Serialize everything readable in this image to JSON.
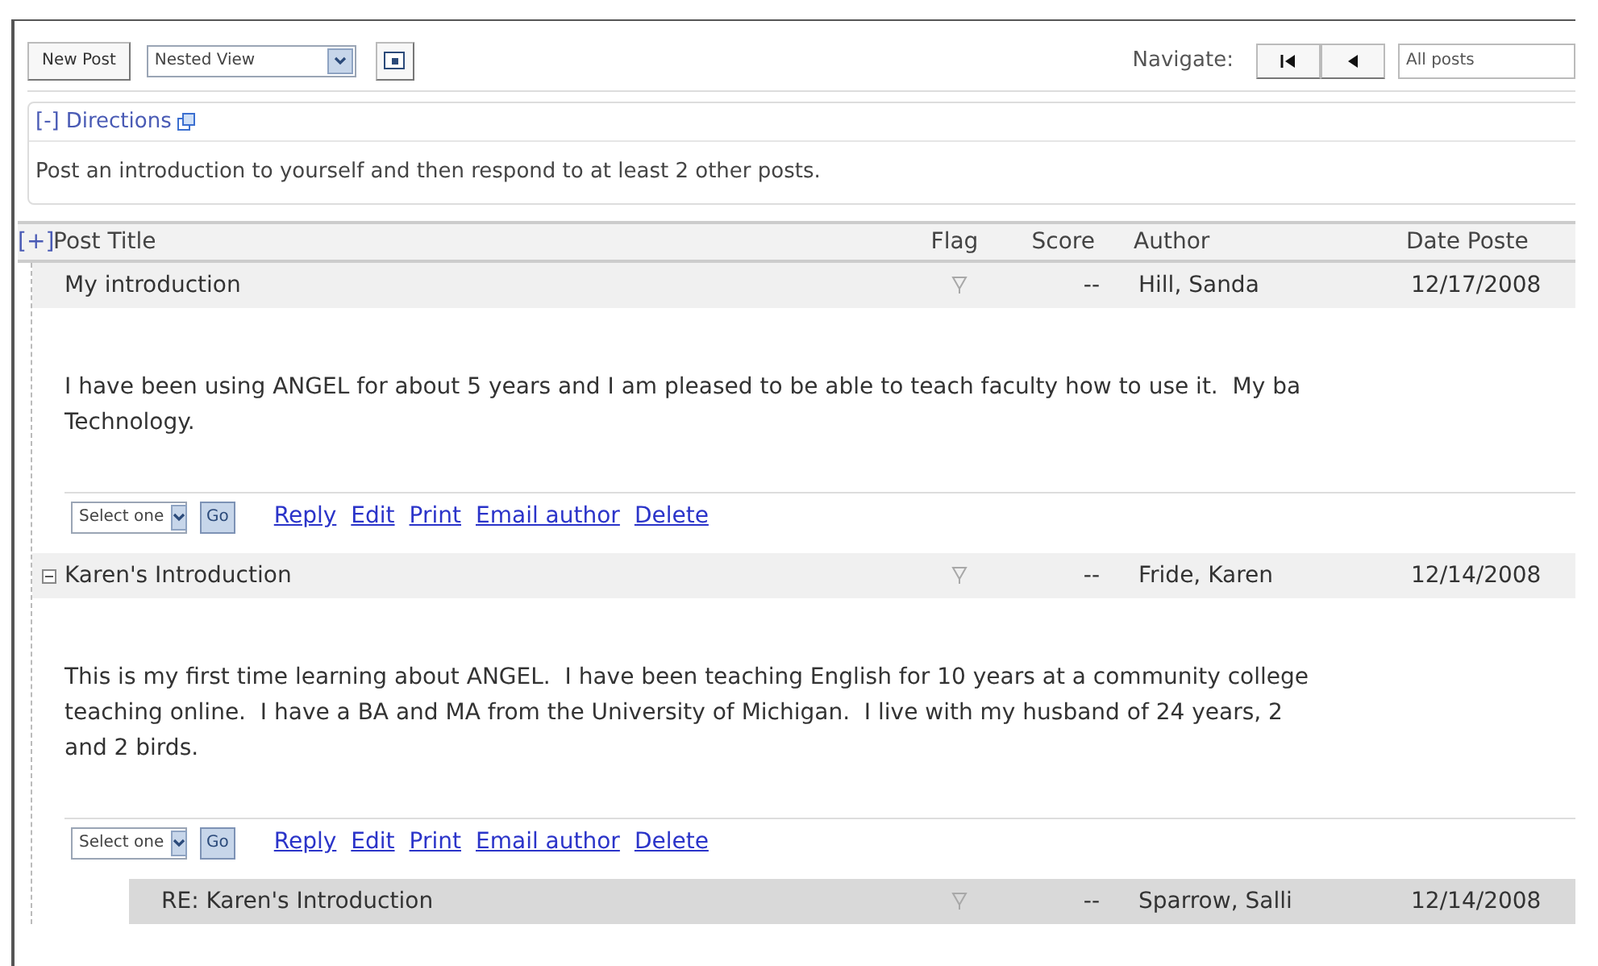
{
  "toolbar": {
    "new_post": "New Post",
    "view_select": "Nested View",
    "navigate_label": "Navigate:",
    "filter_select": "All posts"
  },
  "directions": {
    "toggle": "[-]",
    "title": "Directions",
    "text": "Post an introduction to yourself and then respond to at least 2 other posts."
  },
  "table": {
    "toggle": "[+]",
    "columns": [
      "Post Title",
      "Flag",
      "Score",
      "Author",
      "Date Poste"
    ],
    "posts": [
      {
        "title": "My introduction",
        "score": "--",
        "author": "Hill, Sanda",
        "date": "12/17/2008",
        "selected": false,
        "body_lines": [
          "I have been using ANGEL for about 5 years and I am pleased to be able to teach faculty how to use it.  My ba",
          "Technology."
        ],
        "actions": {
          "select": "Select one",
          "go": "Go",
          "links": [
            "Reply",
            "Edit",
            "Print",
            "Email author",
            "Delete"
          ]
        }
      },
      {
        "title": "Karen's Introduction",
        "score": "--",
        "author": "Fride, Karen",
        "date": "12/14/2008",
        "selected": false,
        "expanded": true,
        "body_lines": [
          "This is my first time learning about ANGEL.  I have been teaching English for 10 years at a community college",
          "teaching online.  I have a BA and MA from the University of Michigan.  I live with my husband of 24 years, 2",
          "and 2 birds."
        ],
        "actions": {
          "select": "Select one",
          "go": "Go",
          "links": [
            "Reply",
            "Edit",
            "Print",
            "Email author",
            "Delete"
          ]
        },
        "children": [
          {
            "title": "RE: Karen's Introduction",
            "score": "--",
            "author": "Sparrow, Salli",
            "date": "12/14/2008",
            "selected": true
          }
        ]
      }
    ]
  }
}
